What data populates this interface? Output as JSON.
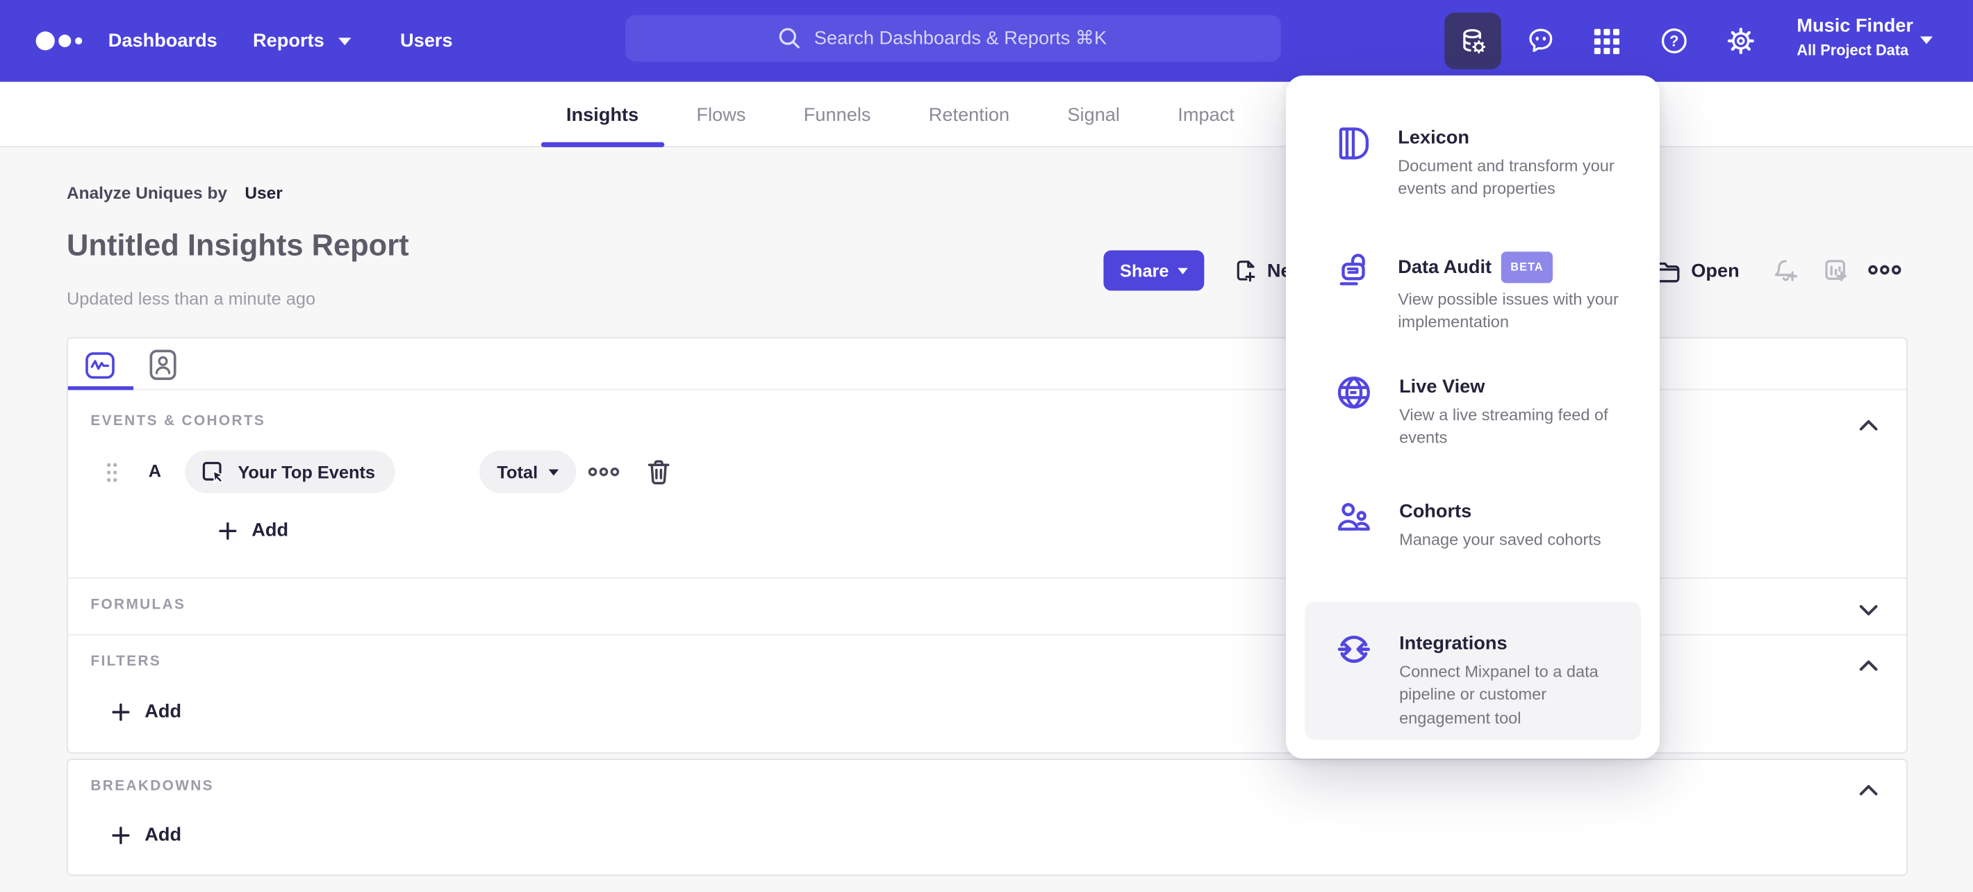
{
  "nav": {
    "items": [
      {
        "label": "Dashboards"
      },
      {
        "label": "Reports"
      },
      {
        "label": "Users"
      }
    ],
    "search": {
      "placeholder": "Search Dashboards & Reports ⌘K"
    },
    "icon_names": [
      "data-management-icon",
      "feedback-icon",
      "apps-grid-icon",
      "help-icon",
      "settings-icon"
    ],
    "project": {
      "name": "Music Finder",
      "scope": "All Project Data"
    }
  },
  "tabs": [
    {
      "label": "Insights",
      "active": true
    },
    {
      "label": "Flows",
      "active": false
    },
    {
      "label": "Funnels",
      "active": false
    },
    {
      "label": "Retention",
      "active": false
    },
    {
      "label": "Signal",
      "active": false
    },
    {
      "label": "Impact",
      "active": false
    }
  ],
  "report": {
    "analyze_prefix": "Analyze Uniques by",
    "analyze_value": "User",
    "title": "Untitled Insights Report",
    "updated": "Updated less than a minute ago",
    "share_label": "Share",
    "new_label": "New",
    "open_label": "Open"
  },
  "builder": {
    "events": {
      "header": "EVENTS & COHORTS",
      "row_label": "A",
      "event_name": "Your Top Events",
      "aggregation": "Total",
      "add_label": "Add"
    },
    "formulas": {
      "header": "FORMULAS"
    },
    "filters": {
      "header": "FILTERS",
      "add_label": "Add"
    },
    "breakdowns": {
      "header": "BREAKDOWNS",
      "add_label": "Add"
    }
  },
  "menu": {
    "items": [
      {
        "title": "Lexicon",
        "description": "Document and transform your events and properties",
        "icon": "lexicon-book-icon"
      },
      {
        "title": "Data Audit",
        "badge": "BETA",
        "description": "View possible issues with your implementation",
        "icon": "data-audit-lock-icon"
      },
      {
        "title": "Live View",
        "description": "View a live streaming feed of events",
        "icon": "live-view-globe-icon"
      },
      {
        "title": "Cohorts",
        "description": "Manage your saved cohorts",
        "icon": "cohorts-people-icon"
      },
      {
        "title": "Integrations",
        "description": "Connect Mixpanel to a data pipeline or customer engagement tool",
        "icon": "integrations-sync-icon",
        "hovered": true
      }
    ]
  },
  "colors": {
    "nav_background": "#4b42dc",
    "accent_purple": "#4f44e0",
    "active_icon_background": "#3a356f",
    "beta_badge": "#8d88ea",
    "text_dark": "#23223a",
    "text_grey": "#9b9aa6",
    "card_border": "#e4e4e8",
    "page_background": "#f7f7f8"
  }
}
